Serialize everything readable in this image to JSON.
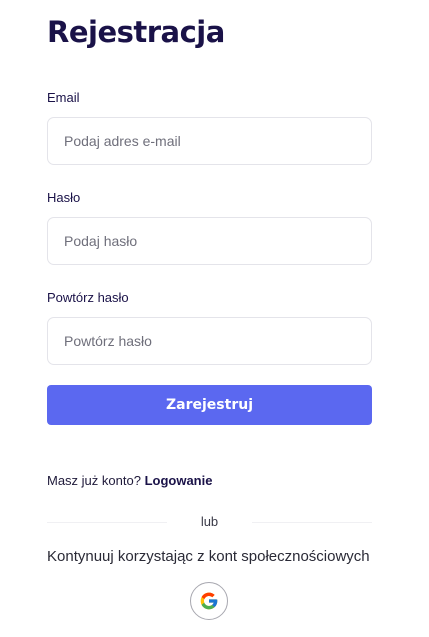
{
  "page": {
    "title": "Rejestracja"
  },
  "form": {
    "email": {
      "label": "Email",
      "placeholder": "Podaj adres e-mail",
      "value": ""
    },
    "password": {
      "label": "Hasło",
      "placeholder": "Podaj hasło",
      "value": ""
    },
    "password_repeat": {
      "label": "Powtórz hasło",
      "placeholder": "Powtórz hasło",
      "value": ""
    },
    "submit_label": "Zarejestruj"
  },
  "login": {
    "prompt": "Masz już konto?",
    "link_label": "Logowanie"
  },
  "divider": {
    "label": "lub"
  },
  "social": {
    "caption": "Kontynuuj korzystając z kont społecznościowych",
    "providers": [
      {
        "name": "google",
        "icon": "google-icon"
      }
    ]
  },
  "colors": {
    "primary": "#5b68f0",
    "heading": "#1a1248",
    "border": "#e4e4ea"
  }
}
